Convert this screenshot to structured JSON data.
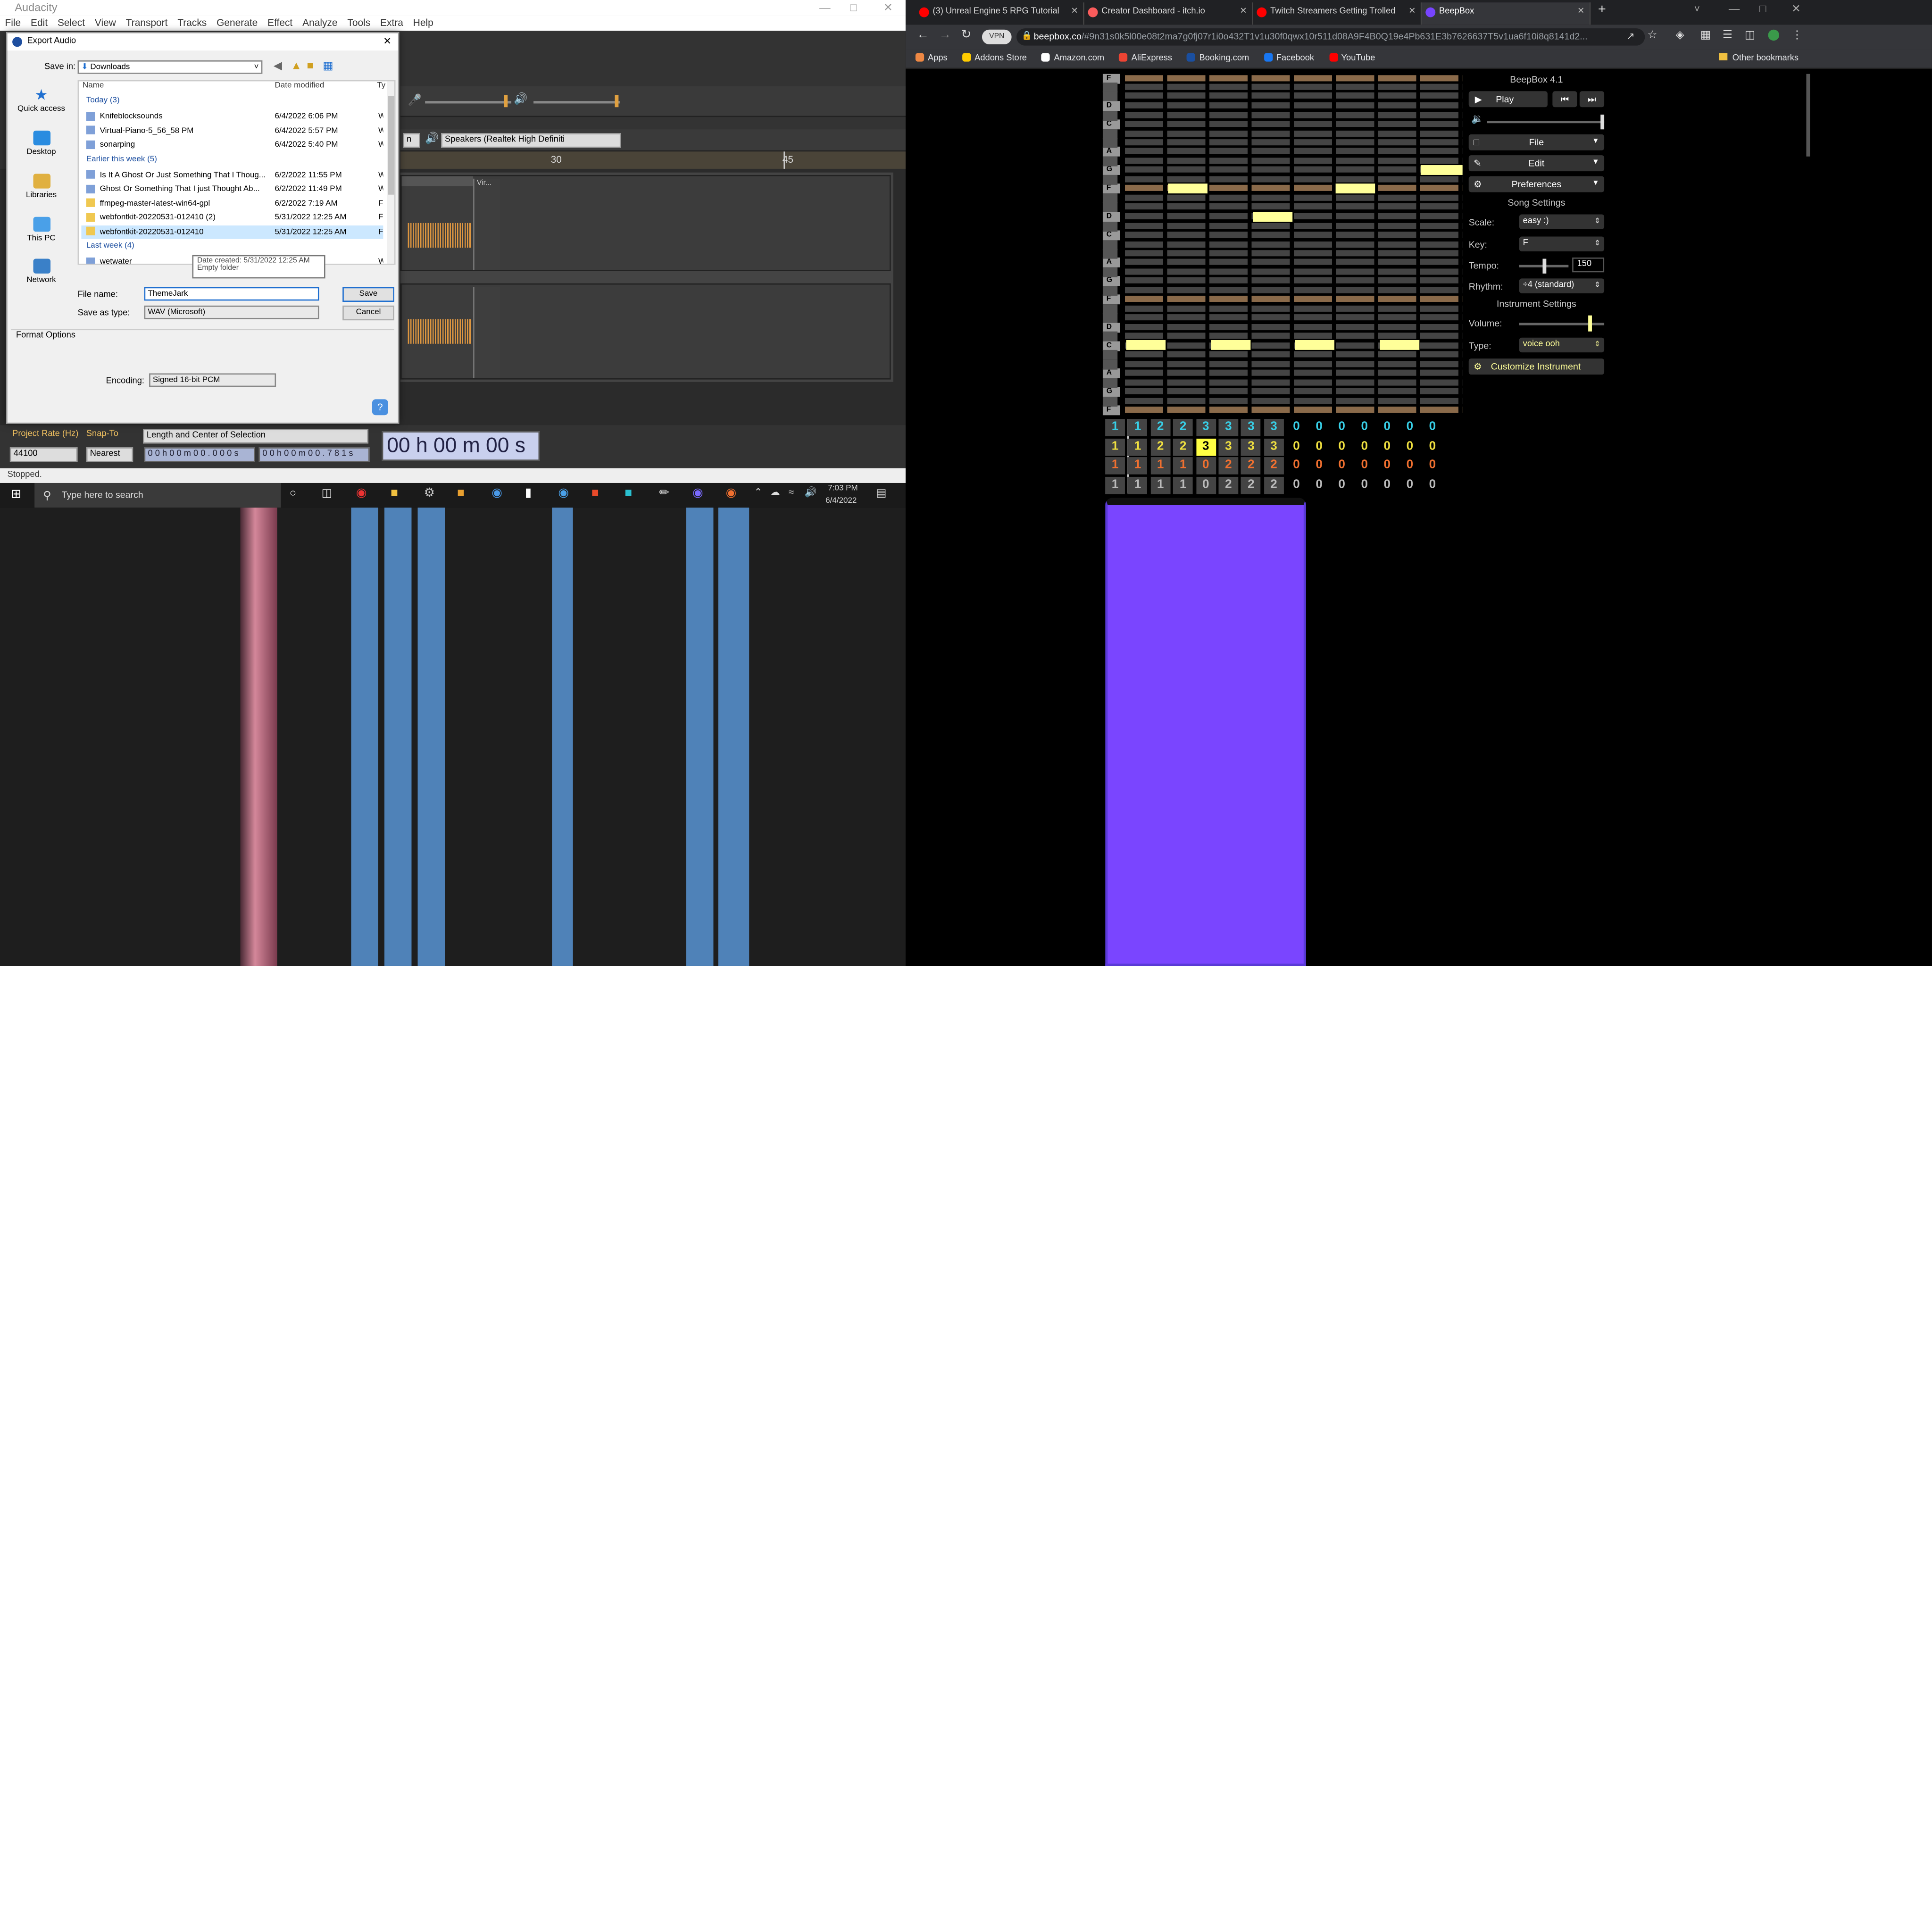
{
  "audacity": {
    "title": "Audacity",
    "menu": [
      "File",
      "Edit",
      "Select",
      "View",
      "Transport",
      "Tracks",
      "Generate",
      "Effect",
      "Analyze",
      "Tools",
      "Extra",
      "Help"
    ],
    "output_device": "Speakers (Realtek High Definiti",
    "ruler_marks": [
      "30",
      "45"
    ],
    "clip_label": "Vir...",
    "project_rate_label": "Project Rate (Hz)",
    "project_rate_value": "44100",
    "snap_to_label": "Snap-To",
    "snap_to_value": "Nearest",
    "selection_mode": "Length and Center of Selection",
    "sel_start": "0 0 h 0 0 m 0 0 . 0 0 0 s",
    "sel_length": "0 0 h 0 0 m 0 0 . 7 8 1 s",
    "big_time": "00 h 00 m 00 s",
    "status": "Stopped."
  },
  "export_dialog": {
    "title": "Export Audio",
    "save_in_label": "Save in:",
    "save_in_value": "Downloads",
    "places": [
      "Quick access",
      "Desktop",
      "Libraries",
      "This PC",
      "Network"
    ],
    "col_name": "Name",
    "col_date": "Date modified",
    "col_type": "Ty",
    "groups": [
      {
        "label": "Today (3)",
        "files": [
          {
            "name": "Knifeblocksounds",
            "date": "6/4/2022 6:06 PM",
            "type": "W"
          },
          {
            "name": "Virtual-Piano-5_56_58 PM",
            "date": "6/4/2022 5:57 PM",
            "type": "W"
          },
          {
            "name": "sonarping",
            "date": "6/4/2022 5:40 PM",
            "type": "W"
          }
        ]
      },
      {
        "label": "Earlier this week (5)",
        "files": [
          {
            "name": "Is It A Ghost Or Just Something That I Thoug...",
            "date": "6/2/2022 11:55 PM",
            "type": "W"
          },
          {
            "name": "Ghost Or Something That I just Thought Ab...",
            "date": "6/2/2022 11:49 PM",
            "type": "W"
          },
          {
            "name": "ffmpeg-master-latest-win64-gpl",
            "date": "6/2/2022 7:19 AM",
            "type": "Fil"
          },
          {
            "name": "webfontkit-20220531-012410 (2)",
            "date": "5/31/2022 12:25 AM",
            "type": "Fil"
          },
          {
            "name": "webfontkit-20220531-012410",
            "date": "5/31/2022 12:25 AM",
            "type": "Fil"
          }
        ]
      },
      {
        "label": "Last week (4)",
        "files": [
          {
            "name": "wetwater",
            "date": "PM",
            "type": "W"
          }
        ]
      }
    ],
    "tooltip_line1": "Date created: 5/31/2022 12:25 AM",
    "tooltip_line2": "Empty folder",
    "file_name_label": "File name:",
    "file_name_value": "ThemeJark",
    "save_type_label": "Save as type:",
    "save_type_value": "WAV (Microsoft)",
    "save_button": "Save",
    "cancel_button": "Cancel",
    "format_options": "Format Options",
    "encoding_label": "Encoding:",
    "encoding_value": "Signed 16-bit PCM",
    "help": "?"
  },
  "taskbar": {
    "search_placeholder": "Type here to search",
    "time": "7:03 PM",
    "date": "6/4/2022"
  },
  "chrome": {
    "tabs": [
      {
        "title": "(3) Unreal Engine 5 RPG Tutorial",
        "color": "#ff0000"
      },
      {
        "title": "Creator Dashboard - itch.io",
        "color": "#fa5c5c"
      },
      {
        "title": "Twitch Streamers Getting Trolled",
        "color": "#ff0000"
      },
      {
        "title": "BeepBox",
        "color": "#7744ff"
      }
    ],
    "vpn_label": "VPN",
    "url_host": "beepbox.co",
    "url_rest": "/#9n31s0k5l00e08t2ma7g0fj07r1i0o432T1v1u30f0qwx10r511d08A9F4B0Q19e4Pb631E3b7626637T5v1ua6f10i8q8141d2...",
    "bookmarks": [
      "Apps",
      "Addons Store",
      "Amazon.com",
      "AliExpress",
      "Booking.com",
      "Facebook",
      "YouTube"
    ],
    "other_bookmarks": "Other bookmarks"
  },
  "beepbox": {
    "version": "BeepBox 4.1",
    "play": "Play",
    "file": "File",
    "edit": "Edit",
    "preferences": "Preferences",
    "song_settings": "Song Settings",
    "scale_label": "Scale:",
    "scale_value": "easy :)",
    "key_label": "Key:",
    "key_value": "F",
    "tempo_label": "Tempo:",
    "tempo_value": "150",
    "rhythm_label": "Rhythm:",
    "rhythm_value": "÷4 (standard)",
    "instrument_settings": "Instrument Settings",
    "volume_label": "Volume:",
    "type_label": "Type:",
    "type_value": "voice ooh",
    "customize": "Customize Instrument",
    "volume_level": 0.85,
    "tempo_level": 0.5,
    "key_labels": [
      "F",
      "D",
      "C",
      "A",
      "G",
      "F",
      "D",
      "C",
      "A",
      "G",
      "F",
      "D",
      "C",
      "A",
      "G",
      "F"
    ],
    "pattern_rows": [
      {
        "color": "#38d0e8",
        "values": [
          "1",
          "1",
          "2",
          "2",
          "3",
          "3",
          "3",
          "3",
          "0",
          "0",
          "0",
          "0",
          "0",
          "0",
          "0"
        ]
      },
      {
        "color": "#f0e040",
        "values": [
          "1",
          "1",
          "2",
          "2",
          "3",
          "3",
          "3",
          "3",
          "0",
          "0",
          "0",
          "0",
          "0",
          "0",
          "0"
        ]
      },
      {
        "color": "#f07030",
        "values": [
          "1",
          "1",
          "1",
          "1",
          "0",
          "2",
          "2",
          "2",
          "0",
          "0",
          "0",
          "0",
          "0",
          "0",
          "0"
        ]
      },
      {
        "color": "#bbbbbb",
        "values": [
          "1",
          "1",
          "1",
          "1",
          "0",
          "2",
          "2",
          "2",
          "0",
          "0",
          "0",
          "0",
          "0",
          "0",
          "0"
        ]
      }
    ]
  }
}
